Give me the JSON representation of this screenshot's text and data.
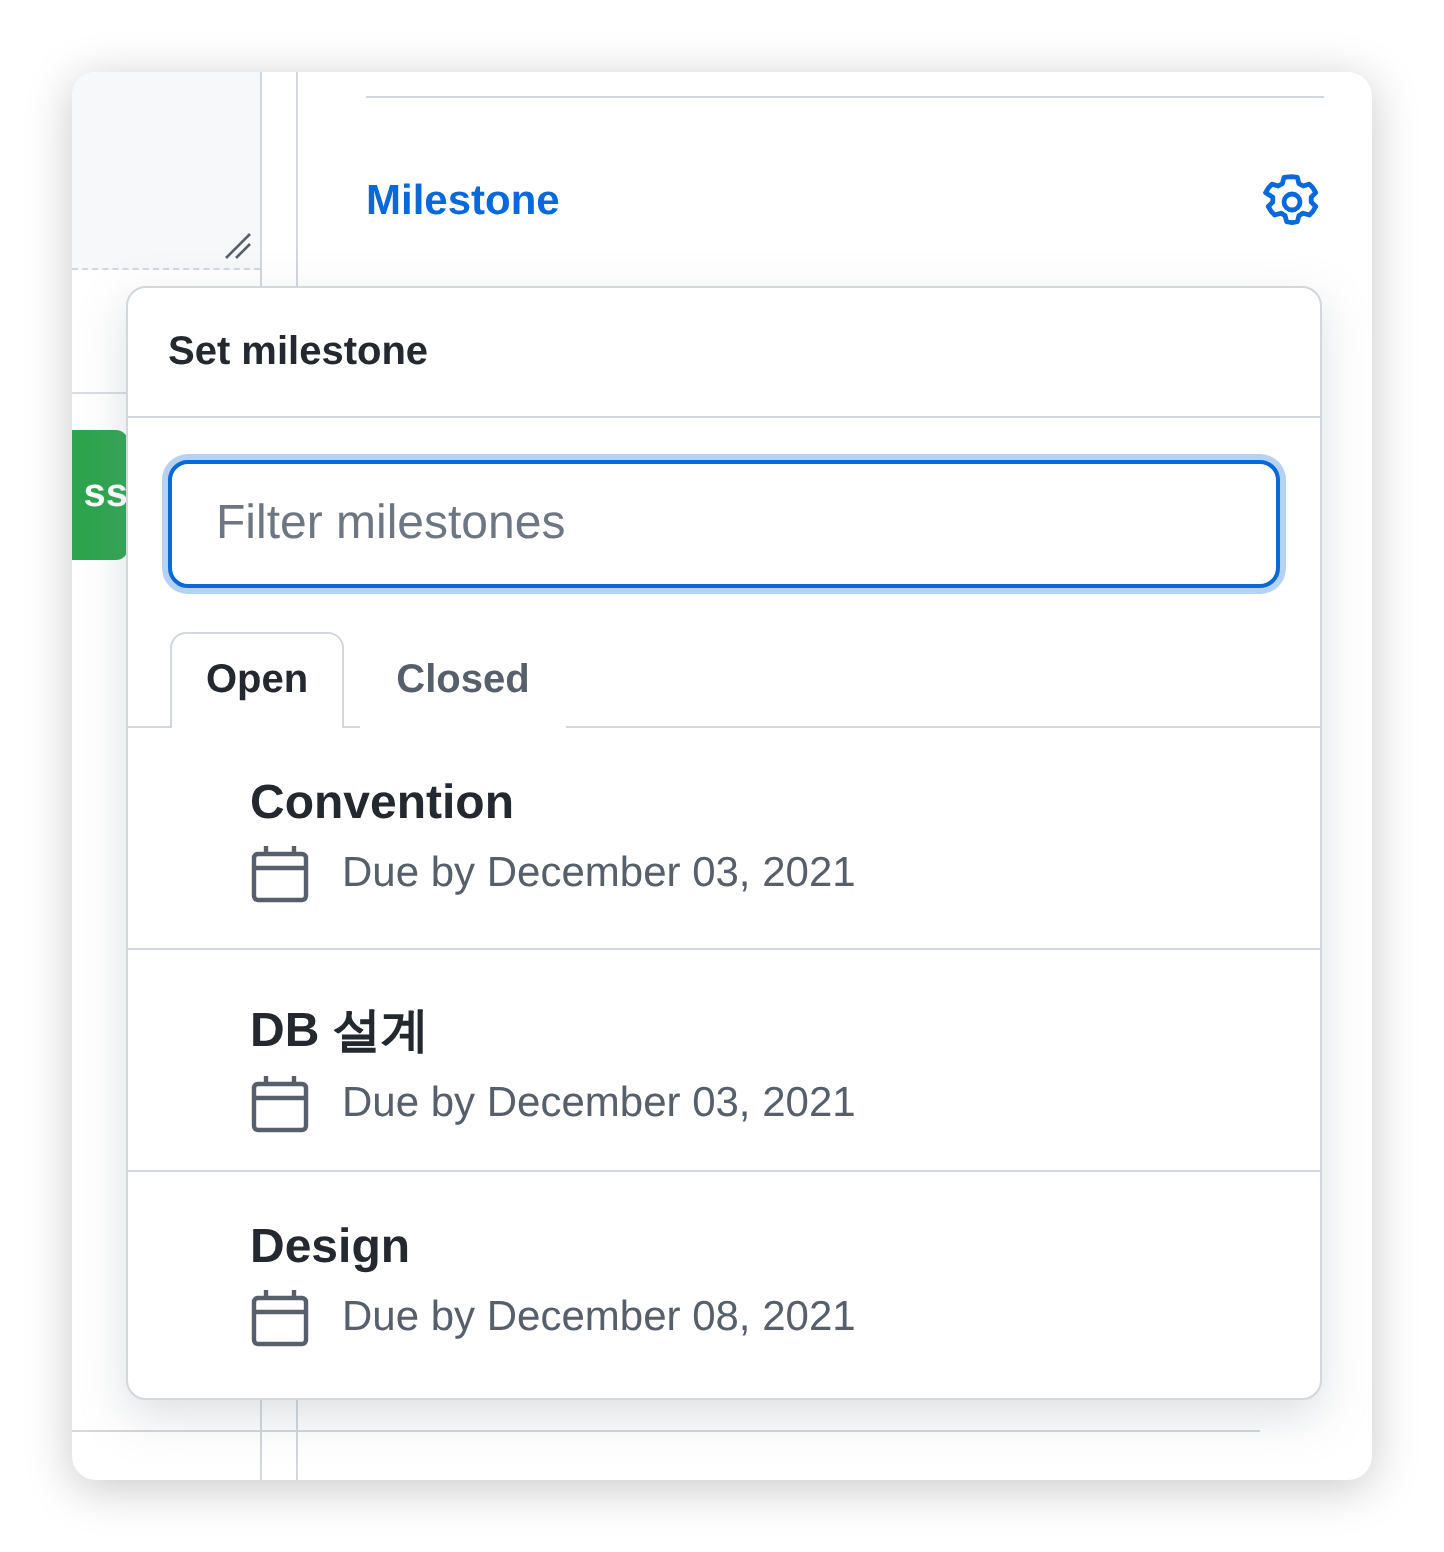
{
  "editor": {
    "submit_button": "ss"
  },
  "sidebar": {
    "section_title": "Milestone"
  },
  "milestone_menu": {
    "title": "Set milestone",
    "filter": {
      "placeholder": "Filter milestones"
    },
    "tabs": [
      {
        "label": "Open",
        "selected": true
      },
      {
        "label": "Closed",
        "selected": false
      }
    ],
    "milestones": [
      {
        "title": "Convention",
        "due": "Due by December 03, 2021"
      },
      {
        "title": "DB 설계",
        "due": "Due by December 03, 2021"
      },
      {
        "title": "Design",
        "due": "Due by December 08, 2021"
      }
    ]
  }
}
